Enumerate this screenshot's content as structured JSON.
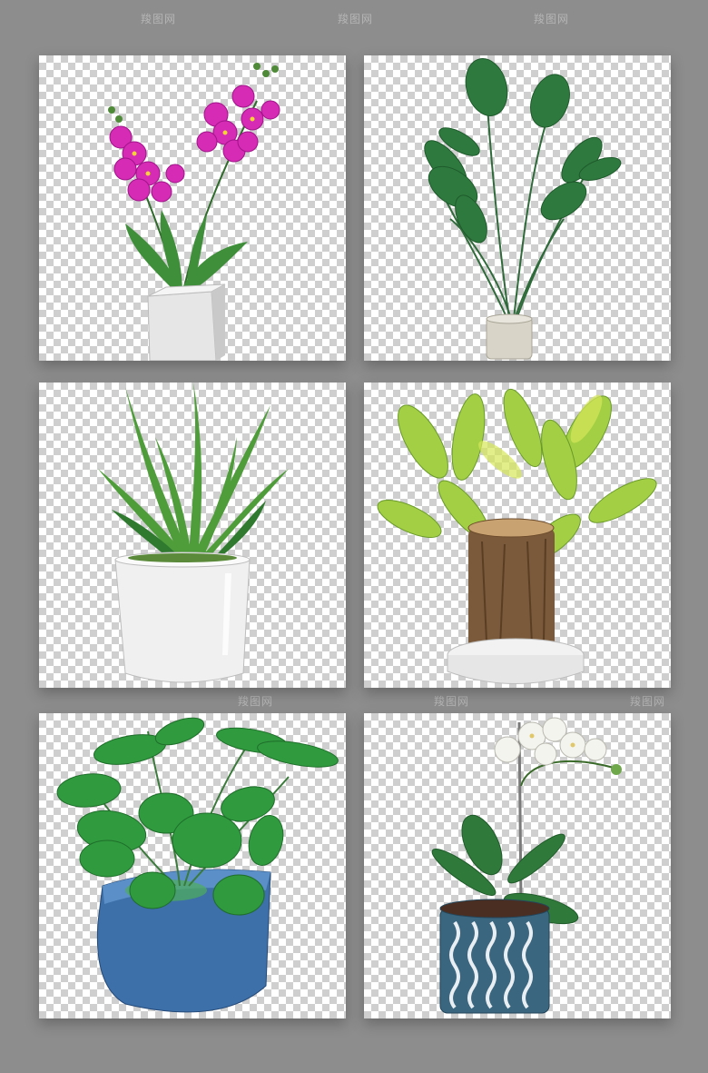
{
  "watermark": {
    "text": "羧图网"
  },
  "panels": [
    {
      "plant": "magenta orchid in white square pot"
    },
    {
      "plant": "bird of paradise in cream pot"
    },
    {
      "plant": "spider grass in white ceramic pot"
    },
    {
      "plant": "lucky wood stump in shallow white dish"
    },
    {
      "plant": "money plant in blue glazed pot"
    },
    {
      "plant": "white orchid in blue wavy-pattern pot"
    }
  ],
  "colors": {
    "background": "#8d8d8d",
    "checker_light": "#ffffff",
    "checker_dark": "#cfcfcf",
    "orchid_pink": "#d62bb4",
    "leaf_green": "#3f9b3f",
    "blue_pot": "#3d6fa8"
  }
}
